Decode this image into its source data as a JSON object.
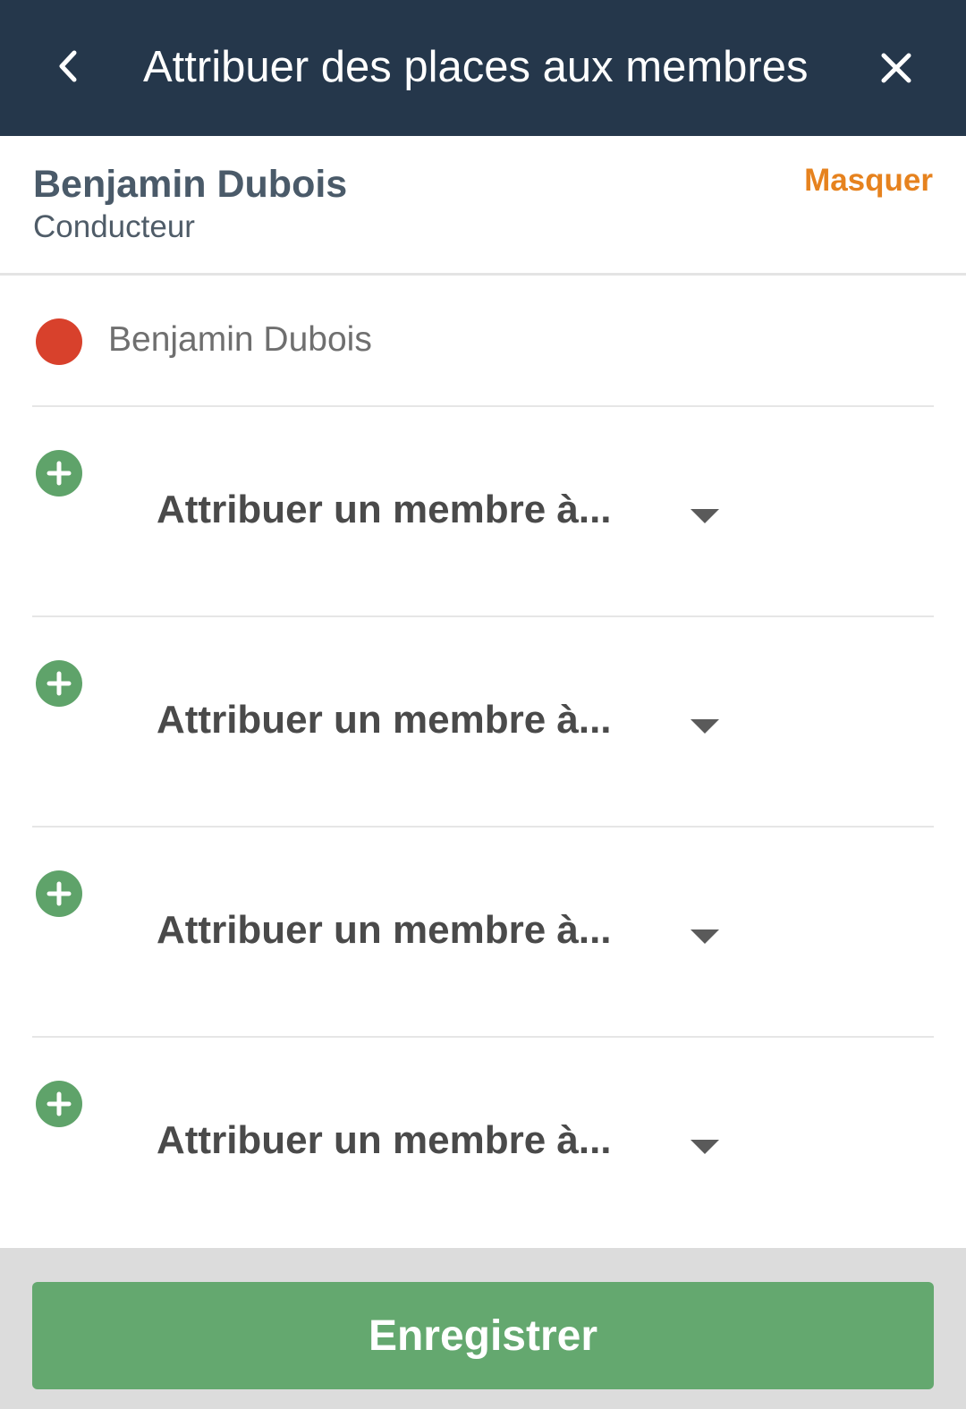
{
  "header": {
    "title": "Attribuer des places aux membres",
    "back_icon": "chevron-left-icon",
    "close_icon": "close-icon"
  },
  "vehicle": {
    "owner_name": "Benjamin Dubois",
    "role": "Conducteur",
    "hide_label": "Masquer"
  },
  "driver": {
    "name": "Benjamin Dubois",
    "marker_color": "#d8412c"
  },
  "seats": [
    {
      "placeholder": "Attribuer un membre à..."
    },
    {
      "placeholder": "Attribuer un membre à..."
    },
    {
      "placeholder": "Attribuer un membre à..."
    },
    {
      "placeholder": "Attribuer un membre à..."
    }
  ],
  "footer": {
    "save_label": "Enregistrer"
  },
  "colors": {
    "header_bg": "#25374b",
    "accent_orange": "#e6821e",
    "accent_green": "#64a86f"
  }
}
